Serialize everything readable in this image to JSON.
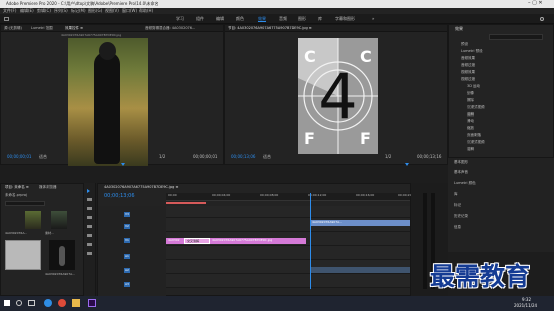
{
  "window": {
    "title": "Adobe Premiere Pro 2020 - C:\\用户\\dtop\\文稿\\Adobe\\Premiere Pro\\14.0\\未命名"
  },
  "menu": {
    "items": [
      "文件(F)",
      "编辑(E)",
      "剪辑(C)",
      "序列(S)",
      "标记(M)",
      "图形(G)",
      "视图(V)",
      "窗口(W)",
      "帮助(H)"
    ]
  },
  "workspace": {
    "tabs": [
      "学习",
      "组件",
      "编辑",
      "颜色",
      "效果",
      "音频",
      "图形",
      "库",
      "字幕和图形",
      "»"
    ],
    "active_index": 4
  },
  "source_panel": {
    "tabs": [
      "源:(无剪辑)",
      "Lumetri 范围",
      "效果控件 ≡",
      "音频剪辑混合器: 4A0302076..."
    ],
    "clip_label": "4A0302076A907A6775A907B7DE90.jpg",
    "timecode": "00;00;00;01",
    "fit": "适合",
    "ratio": "1/2",
    "duration": "00;00;00;01"
  },
  "program_panel": {
    "tab": "节目: 4A0302076A907A6775A907B7DE9C.jpg ≡",
    "timecode": "00;00;13;06",
    "fit": "适合",
    "ratio": "1/2",
    "duration": "00;00;13;16",
    "leader": {
      "number": "4",
      "corner_letters": [
        "C",
        "C",
        "F",
        "F"
      ]
    }
  },
  "project_panel": {
    "tabs": [
      "项目: 未命名 ≡",
      "媒体浏览器"
    ],
    "path": "未命名.prproj",
    "items": [
      {
        "label": "4A0302076A...",
        "duration": ""
      },
      {
        "label": "素材...",
        "duration": ""
      },
      {
        "label": "",
        "duration": ""
      },
      {
        "label": "4A0302076A907A...",
        "duration": ""
      }
    ]
  },
  "timeline": {
    "tab": "4A0302076A907A6775A907B7DE9C.jpg ≡",
    "timecode": "00;00;13;06",
    "ruler": [
      "00;00",
      "00;00;04;00",
      "00;00;08;00",
      "00;00;12;00",
      "00;00;16;00",
      "00;00;20;00"
    ],
    "tracks": [
      "V3",
      "V2",
      "V1",
      "A1",
      "A2",
      "A3"
    ],
    "clips": [
      {
        "name": "4A0302076A907A...",
        "track": "V2",
        "color": "#6d8fc9"
      },
      {
        "name": "4A0302",
        "track": "V1",
        "color": "#d57ad7"
      },
      {
        "name": "交叉溶解",
        "track": "V1",
        "color": "#e9a4e5"
      },
      {
        "name": "4A0302076A907A6775A907B7DE9C.jpg",
        "track": "V1",
        "color": "#d57ad7"
      },
      {
        "name": "",
        "track": "A2",
        "color": "#3f546e"
      }
    ]
  },
  "effects_panel": {
    "title": "效果",
    "search_placeholder": "",
    "tree": [
      "预设",
      "Lumetri 预设",
      "音频效果",
      "音频过渡",
      "视频效果",
      "视频过渡",
      "3D 运动",
      "划像",
      "擦除",
      "沉浸式视频",
      "溶解",
      "滑动",
      "缩放",
      "页面剥落",
      "沉浸式视频",
      "溶解"
    ]
  },
  "side_panels": [
    "基本图形",
    "基本声音",
    "Lumetri 颜色",
    "库",
    "标记",
    "历史记录",
    "信息"
  ],
  "taskbar": {
    "time": "9:32",
    "date": "2021/11/24"
  },
  "watermark": "最需教育",
  "colors": {
    "accent": "#2d8ceb",
    "timecode": "#2d8ceb",
    "leader_bg": "#9a9a9a"
  }
}
